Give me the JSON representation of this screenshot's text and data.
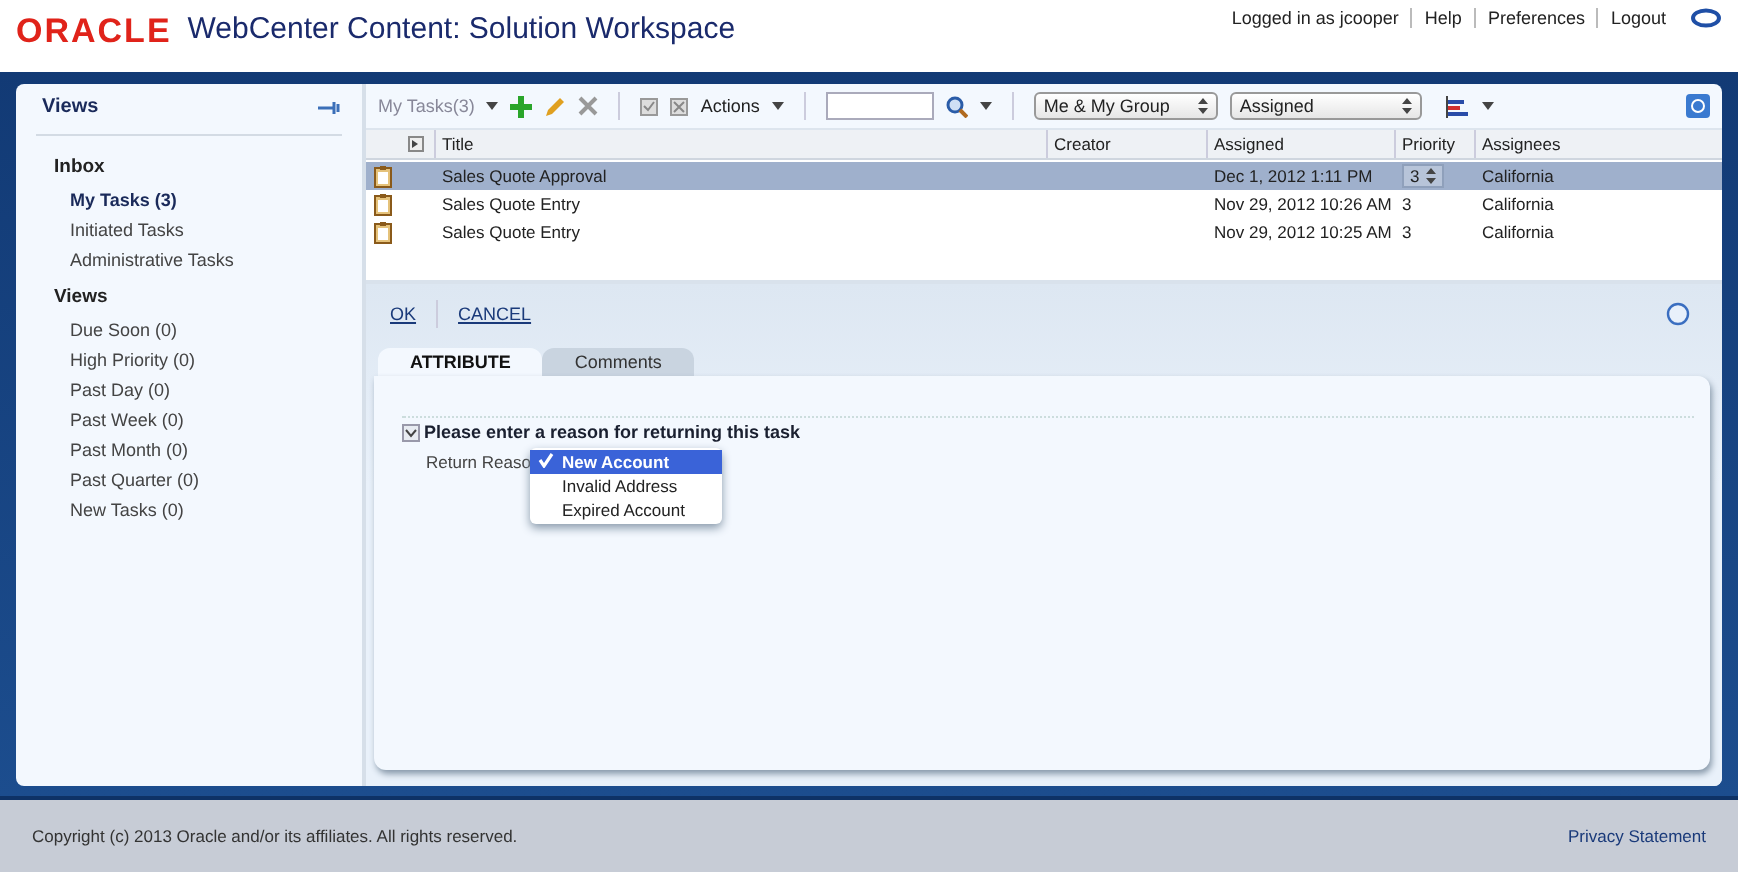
{
  "header": {
    "logo": "ORACLE",
    "title": "WebCenter Content: Solution Workspace",
    "links": [
      "Logged in as jcooper",
      "Help",
      "Preferences",
      "Logout"
    ]
  },
  "sidebar": {
    "title": "Views",
    "sections": [
      {
        "title": "Inbox",
        "items": [
          {
            "label": "My Tasks (3)",
            "selected": true
          },
          {
            "label": "Initiated Tasks",
            "selected": false
          },
          {
            "label": "Administrative Tasks",
            "selected": false
          }
        ]
      },
      {
        "title": "Views",
        "items": [
          {
            "label": "Due Soon (0)",
            "selected": false
          },
          {
            "label": "High Priority (0)",
            "selected": false
          },
          {
            "label": "Past Day (0)",
            "selected": false
          },
          {
            "label": "Past Week (0)",
            "selected": false
          },
          {
            "label": "Past Month (0)",
            "selected": false
          },
          {
            "label": "Past Quarter (0)",
            "selected": false
          },
          {
            "label": "New Tasks (0)",
            "selected": false
          }
        ]
      }
    ]
  },
  "toolbar": {
    "task_menu": "My Tasks(3)",
    "actions": "Actions",
    "filters": [
      "Me & My Group",
      "Assigned"
    ]
  },
  "table": {
    "columns": [
      "Title",
      "Creator",
      "Assigned",
      "Priority",
      "Assignees"
    ],
    "rows": [
      {
        "title": "Sales Quote Approval",
        "creator": "",
        "assigned": "Dec 1, 2012 1:11 PM",
        "priority": "3",
        "assignees": "California",
        "selected": true
      },
      {
        "title": "Sales Quote Entry",
        "creator": "",
        "assigned": "Nov 29, 2012 10:26 AM",
        "priority": "3",
        "assignees": "California",
        "selected": false
      },
      {
        "title": "Sales Quote Entry",
        "creator": "",
        "assigned": "Nov 29, 2012 10:25 AM",
        "priority": "3",
        "assignees": "California",
        "selected": false
      }
    ]
  },
  "detail": {
    "actions": [
      "OK",
      "CANCEL"
    ],
    "tabs": [
      {
        "label": "ATTRIBUTE",
        "selected": true
      },
      {
        "label": "Comments",
        "selected": false
      }
    ],
    "section_title": "Please enter a reason for returning this task",
    "field_label": "Return Reaso",
    "options": [
      {
        "label": "New Account",
        "selected": true
      },
      {
        "label": "Invalid Address",
        "selected": false
      },
      {
        "label": "Expired Account",
        "selected": false
      }
    ]
  },
  "footer": {
    "copyright": "Copyright (c) 2013 Oracle and/or its affiliates. All rights reserved.",
    "privacy": "Privacy Statement"
  }
}
